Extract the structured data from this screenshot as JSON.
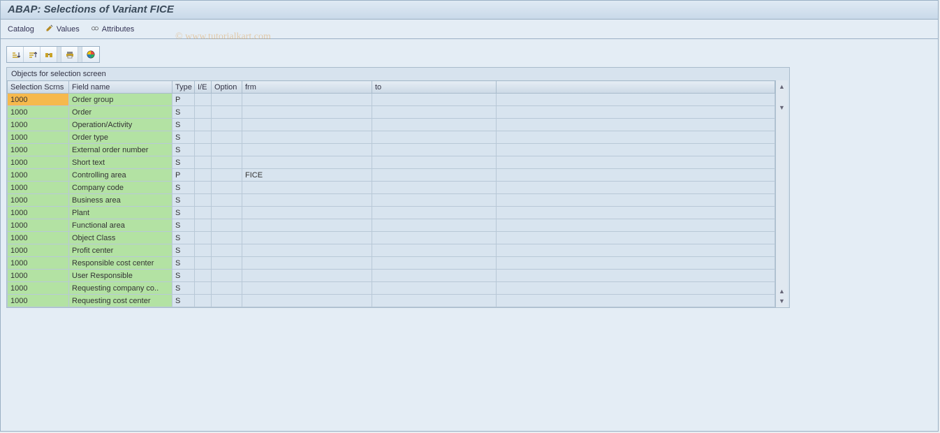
{
  "header": {
    "title": "ABAP: Selections of Variant FICE"
  },
  "toolbar": {
    "catalog": "Catalog",
    "values": "Values",
    "attributes": "Attributes"
  },
  "watermark": "© www.tutorialkart.com",
  "panel": {
    "title": "Objects for selection screen",
    "columns": [
      "Selection Scrns",
      "Field name",
      "Type",
      "I/E",
      "Option",
      "frm",
      "to"
    ],
    "rows": [
      {
        "scrn": "1000",
        "selected": true,
        "field": "Order group",
        "type": "P",
        "ie": "",
        "option": "",
        "frm": "",
        "to": ""
      },
      {
        "scrn": "1000",
        "selected": false,
        "field": "Order",
        "type": "S",
        "ie": "",
        "option": "",
        "frm": "",
        "to": ""
      },
      {
        "scrn": "1000",
        "selected": false,
        "field": "Operation/Activity",
        "type": "S",
        "ie": "",
        "option": "",
        "frm": "",
        "to": ""
      },
      {
        "scrn": "1000",
        "selected": false,
        "field": "Order type",
        "type": "S",
        "ie": "",
        "option": "",
        "frm": "",
        "to": ""
      },
      {
        "scrn": "1000",
        "selected": false,
        "field": "External order number",
        "type": "S",
        "ie": "",
        "option": "",
        "frm": "",
        "to": ""
      },
      {
        "scrn": "1000",
        "selected": false,
        "field": "Short text",
        "type": "S",
        "ie": "",
        "option": "",
        "frm": "",
        "to": ""
      },
      {
        "scrn": "1000",
        "selected": false,
        "field": "Controlling area",
        "type": "P",
        "ie": "",
        "option": "",
        "frm": "FICE",
        "to": ""
      },
      {
        "scrn": "1000",
        "selected": false,
        "field": "Company code",
        "type": "S",
        "ie": "",
        "option": "",
        "frm": "",
        "to": ""
      },
      {
        "scrn": "1000",
        "selected": false,
        "field": "Business area",
        "type": "S",
        "ie": "",
        "option": "",
        "frm": "",
        "to": ""
      },
      {
        "scrn": "1000",
        "selected": false,
        "field": "Plant",
        "type": "S",
        "ie": "",
        "option": "",
        "frm": "",
        "to": ""
      },
      {
        "scrn": "1000",
        "selected": false,
        "field": "Functional area",
        "type": "S",
        "ie": "",
        "option": "",
        "frm": "",
        "to": ""
      },
      {
        "scrn": "1000",
        "selected": false,
        "field": "Object Class",
        "type": "S",
        "ie": "",
        "option": "",
        "frm": "",
        "to": ""
      },
      {
        "scrn": "1000",
        "selected": false,
        "field": "Profit center",
        "type": "S",
        "ie": "",
        "option": "",
        "frm": "",
        "to": ""
      },
      {
        "scrn": "1000",
        "selected": false,
        "field": "Responsible cost center",
        "type": "S",
        "ie": "",
        "option": "",
        "frm": "",
        "to": ""
      },
      {
        "scrn": "1000",
        "selected": false,
        "field": "User Responsible",
        "type": "S",
        "ie": "",
        "option": "",
        "frm": "",
        "to": ""
      },
      {
        "scrn": "1000",
        "selected": false,
        "field": "Requesting company co..",
        "type": "S",
        "ie": "",
        "option": "",
        "frm": "",
        "to": ""
      },
      {
        "scrn": "1000",
        "selected": false,
        "field": "Requesting cost center",
        "type": "S",
        "ie": "",
        "option": "",
        "frm": "",
        "to": ""
      }
    ]
  }
}
